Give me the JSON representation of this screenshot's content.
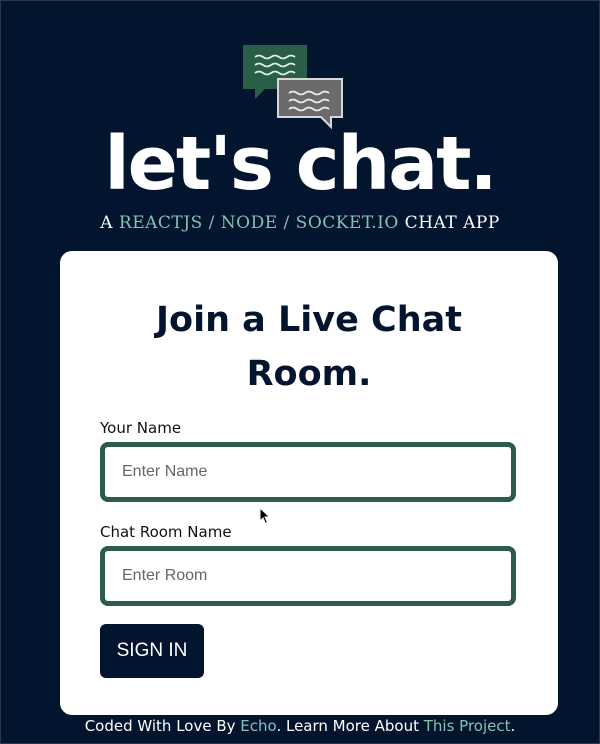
{
  "header": {
    "brand": "let's chat.",
    "tagline": {
      "prefix": "A ",
      "tech1": "REACTJS",
      "sep1": " / ",
      "tech2": "NODE",
      "sep2": " / ",
      "tech3": "SOCKET.IO",
      "suffix": " CHAT APP"
    },
    "logo_icon": "chat-bubbles-icon"
  },
  "form": {
    "title_line1": "Join a Live Chat",
    "title_line2": "Room.",
    "name_label": "Your Name",
    "name_placeholder": "Enter Name",
    "name_value": "",
    "room_label": "Chat Room Name",
    "room_placeholder": "Enter Room",
    "room_value": "",
    "submit_label": "SIGN IN"
  },
  "footer": {
    "text1": "Coded With Love By ",
    "author_link": "Echo",
    "text2": ". Learn More About ",
    "project_link": "This Project",
    "text3": "."
  },
  "colors": {
    "background": "#03142e",
    "accent": "#84c2b4",
    "input_border": "#2d5c48",
    "bubble_front": "#2b5e46",
    "bubble_back": "#6b6b6b"
  }
}
